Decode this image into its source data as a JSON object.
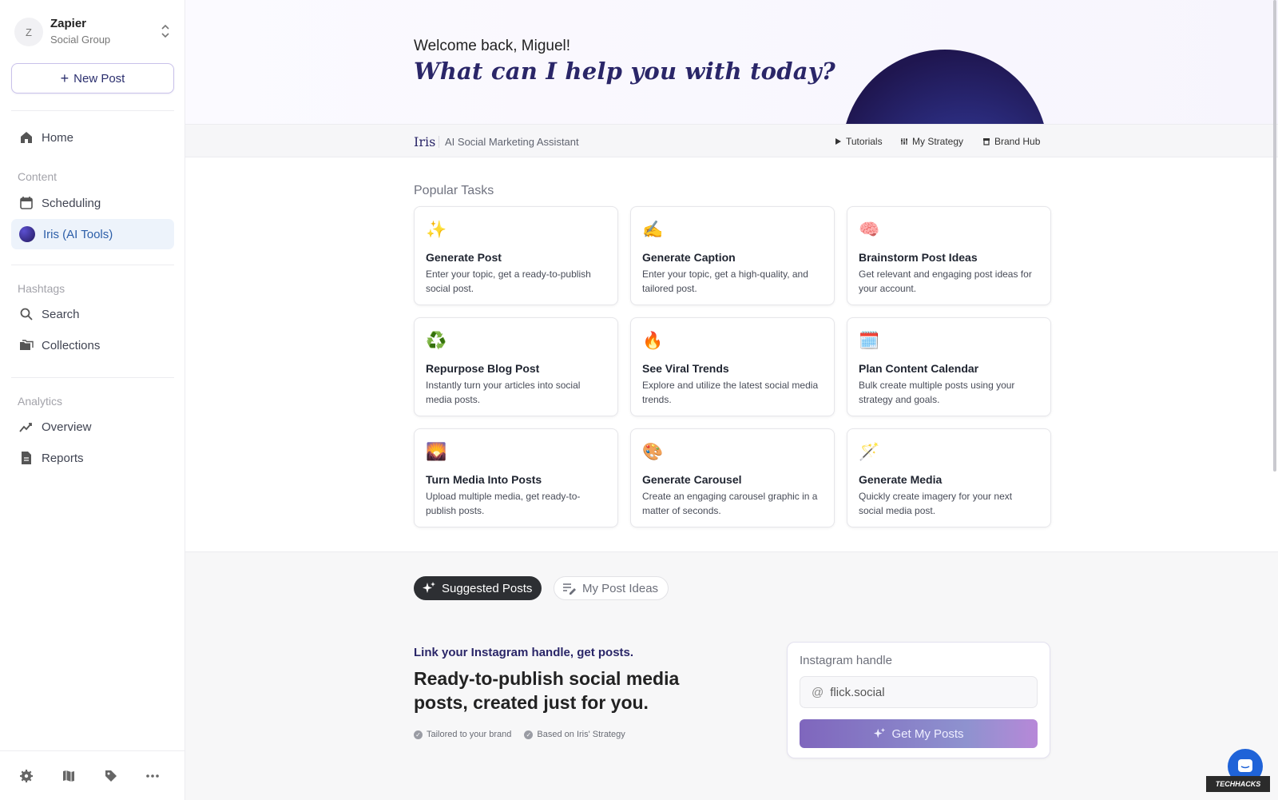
{
  "workspace": {
    "avatar_letter": "Z",
    "name": "Zapier",
    "subtitle": "Social Group"
  },
  "sidebar": {
    "new_post_label": "New Post",
    "home": "Home",
    "content_heading": "Content",
    "scheduling": "Scheduling",
    "iris": "Iris (AI Tools)",
    "hashtags_heading": "Hashtags",
    "search": "Search",
    "collections": "Collections",
    "analytics_heading": "Analytics",
    "overview": "Overview",
    "reports": "Reports"
  },
  "hero": {
    "welcome": "Welcome back, Miguel!",
    "question": "What can I help you with today?"
  },
  "iris_bar": {
    "name": "Iris",
    "subtitle": "AI Social Marketing Assistant",
    "links": [
      "Tutorials",
      "My Strategy",
      "Brand Hub"
    ]
  },
  "popular_tasks": {
    "title": "Popular Tasks",
    "items": [
      {
        "emoji": "✨",
        "title": "Generate Post",
        "desc": "Enter your topic, get a ready-to-publish social post."
      },
      {
        "emoji": "✍️",
        "title": "Generate Caption",
        "desc": "Enter your topic, get a high-quality, and tailored post."
      },
      {
        "emoji": "🧠",
        "title": "Brainstorm Post Ideas",
        "desc": "Get relevant and engaging post ideas for your account."
      },
      {
        "emoji": "♻️",
        "title": "Repurpose Blog Post",
        "desc": "Instantly turn your articles into social media posts."
      },
      {
        "emoji": "🔥",
        "title": "See Viral Trends",
        "desc": "Explore and utilize the latest social media trends."
      },
      {
        "emoji": "🗓️",
        "title": "Plan Content Calendar",
        "desc": "Bulk create multiple posts using your strategy and goals."
      },
      {
        "emoji": "🌄",
        "title": "Turn Media Into Posts",
        "desc": "Upload multiple media, get ready-to-publish posts."
      },
      {
        "emoji": "🎨",
        "title": "Generate Carousel",
        "desc": "Create an engaging carousel graphic in a matter of seconds."
      },
      {
        "emoji": "🪄",
        "title": "Generate Media",
        "desc": "Quickly create imagery for your next social media post."
      }
    ]
  },
  "tabs": {
    "suggested": "Suggested Posts",
    "my_ideas": "My Post Ideas"
  },
  "instagram": {
    "headline": "Link your Instagram handle, get posts.",
    "big_text": "Ready-to-publish social media posts, created just for you.",
    "check1": "Tailored to your brand",
    "check2": "Based on Iris' Strategy",
    "handle_label": "Instagram handle",
    "handle_value": "flick.social",
    "button": "Get My Posts"
  },
  "watermark": "TECHHACKS"
}
